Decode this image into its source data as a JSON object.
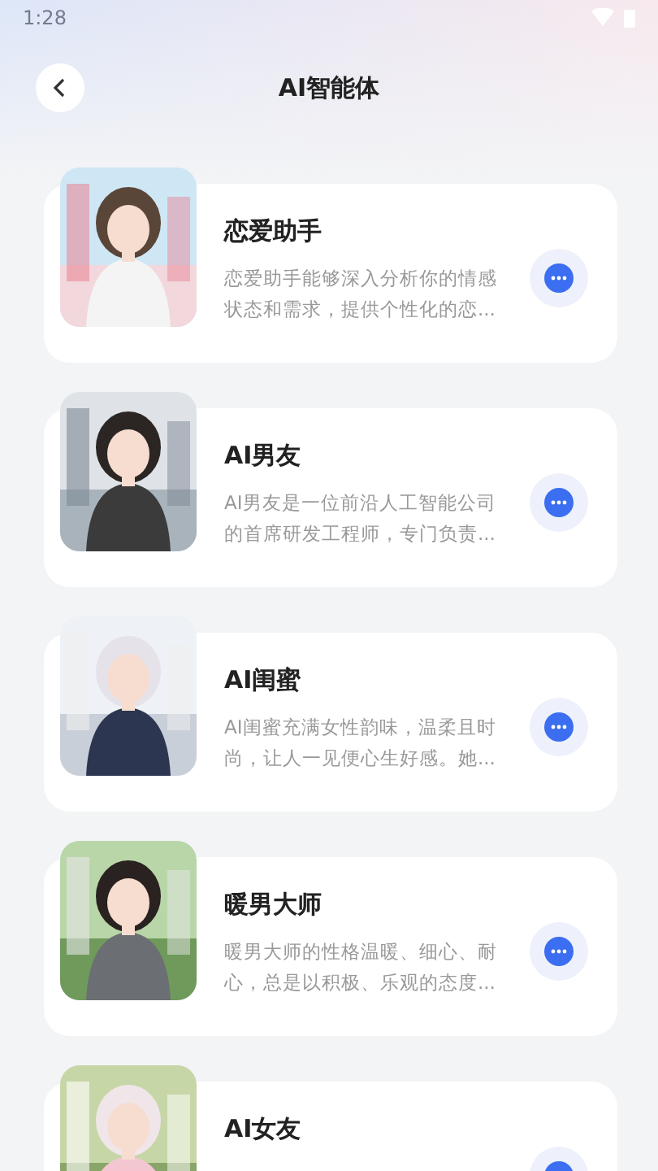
{
  "status_bar": {
    "time": "1:28"
  },
  "header": {
    "title": "AI智能体"
  },
  "agents": [
    {
      "title": "恋爱助手",
      "description": "恋爱助手能够深入分析你的情感状态和需求，提供个性化的恋..."
    },
    {
      "title": "AI男友",
      "description": "AI男友是一位前沿人工智能公司的首席研发工程师，专门负责..."
    },
    {
      "title": "AI闺蜜",
      "description": "AI闺蜜充满女性韵味，温柔且时尚，让人一见便心生好感。她..."
    },
    {
      "title": "暖男大师",
      "description": "暖男大师的性格温暖、细心、耐心，总是以积极、乐观的态度..."
    },
    {
      "title": "AI女友"
    }
  ]
}
